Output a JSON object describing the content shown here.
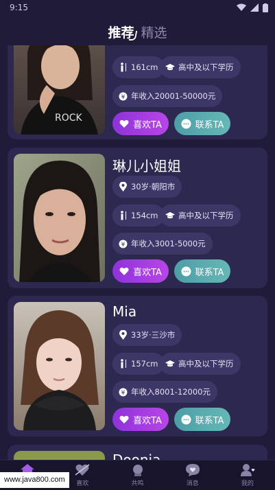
{
  "status_bar": {
    "time": "9:15"
  },
  "tabs": [
    {
      "label": "推荐"
    },
    {
      "label": "精选"
    }
  ],
  "cards": [
    {
      "name": "",
      "age_city": "",
      "height": "161cm",
      "education": "高中及以下学历",
      "income": "年收入20001-50000元",
      "like_label": "喜欢TA",
      "contact_label": "联系TA"
    },
    {
      "name": "琳儿小姐姐",
      "age_city": "30岁·朝阳市",
      "height": "154cm",
      "education": "高中及以下学历",
      "income": "年收入3001-5000元",
      "like_label": "喜欢TA",
      "contact_label": "联系TA"
    },
    {
      "name": "Mia",
      "age_city": "33岁·三沙市",
      "height": "157cm",
      "education": "高中及以下学历",
      "income": "年收入8001-12000元",
      "like_label": "喜欢TA",
      "contact_label": "联系TA"
    },
    {
      "name": "Doonia"
    }
  ],
  "bottom_nav": [
    {
      "label": "",
      "icon": "home-icon"
    },
    {
      "label": "喜欢",
      "icon": "heart-arrow-icon"
    },
    {
      "label": "共鸣",
      "icon": "crystal-ball-icon"
    },
    {
      "label": "消息",
      "icon": "message-heart-icon"
    },
    {
      "label": "我的",
      "icon": "profile-icon"
    }
  ],
  "watermark": "www.java800.com",
  "colors": {
    "background": "#1f1b39",
    "card": "#2d2850",
    "chip": "#3d3767",
    "like": "#a23de0",
    "contact": "#58aaae"
  }
}
